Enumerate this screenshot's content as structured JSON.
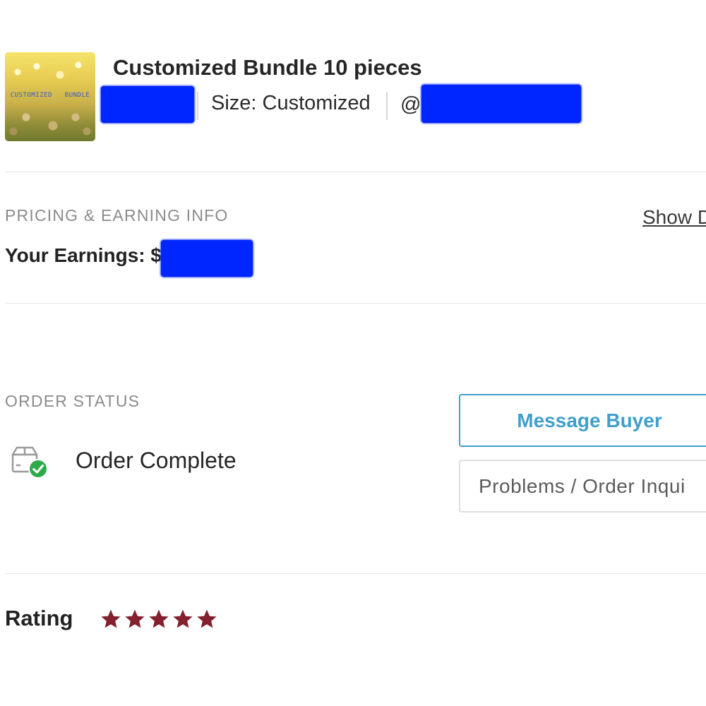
{
  "product": {
    "title": "Customized Bundle 10 pieces",
    "thumbnail_text": "CUSTOMIZED BUNDLE",
    "size": "Size: Customized",
    "handle_prefix": "@"
  },
  "pricing": {
    "section_label": "PRICING & EARNING INFO",
    "show_link": "Show D",
    "earnings_label": "Your Earnings: $"
  },
  "order": {
    "section_label": "ORDER STATUS",
    "status": "Order Complete",
    "status_icon": "box-check-icon",
    "message_button": "Message Buyer",
    "inquiry_button": "Problems / Order Inqui"
  },
  "rating": {
    "label": "Rating",
    "stars": 5,
    "max_stars": 5,
    "star_color": "#85202f"
  },
  "colors": {
    "accent": "#3f9fcd",
    "success": "#2eaa4a",
    "redaction": "#0026ff"
  }
}
